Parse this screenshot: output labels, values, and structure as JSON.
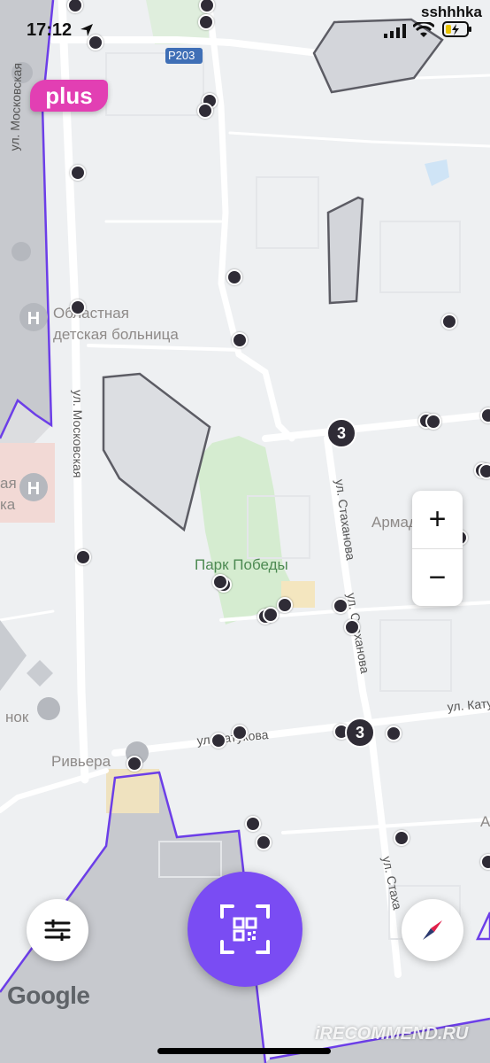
{
  "status_bar": {
    "time": "17:12",
    "carrier": "sshhhka"
  },
  "brand": {
    "badge_label": "plus",
    "badge_color": "#e23fb3"
  },
  "map": {
    "labels": {
      "road_code": "Р203",
      "street_moskovskaya_top": "ул. Московская",
      "street_moskovskaya_mid": "ул. Московская",
      "hospital_line1": "Областная",
      "hospital_line2": "детская больница",
      "park": "Парк Победы",
      "street_stakhanova_1": "ул. Стаханова",
      "street_stakhanova_2": "ул. Стаханова",
      "street_stakhanova_3": "ул. Стаха",
      "street_katukova_1": "ул. Катукова",
      "street_katukova_2": "ул. Кату",
      "armada": "Армад",
      "riviera": "Ривьера",
      "market": "нок",
      "yaya": "ая",
      "ka": "ка",
      "a_right": "А"
    },
    "clusters": [
      "3",
      "3"
    ],
    "zone_border_color": "#6c3ee8",
    "scooter_color": "#2f2c36"
  },
  "zoom_controls": {
    "zoom_in": "+",
    "zoom_out": "−"
  },
  "bottom_bar": {
    "scan_button_color": "#7a4cf3",
    "filters_icon": "filters-icon",
    "scan_icon": "qr-scan-icon",
    "compass_icon": "compass-icon"
  },
  "google_logo": "Google",
  "watermark": "iRECOMMEND.RU"
}
